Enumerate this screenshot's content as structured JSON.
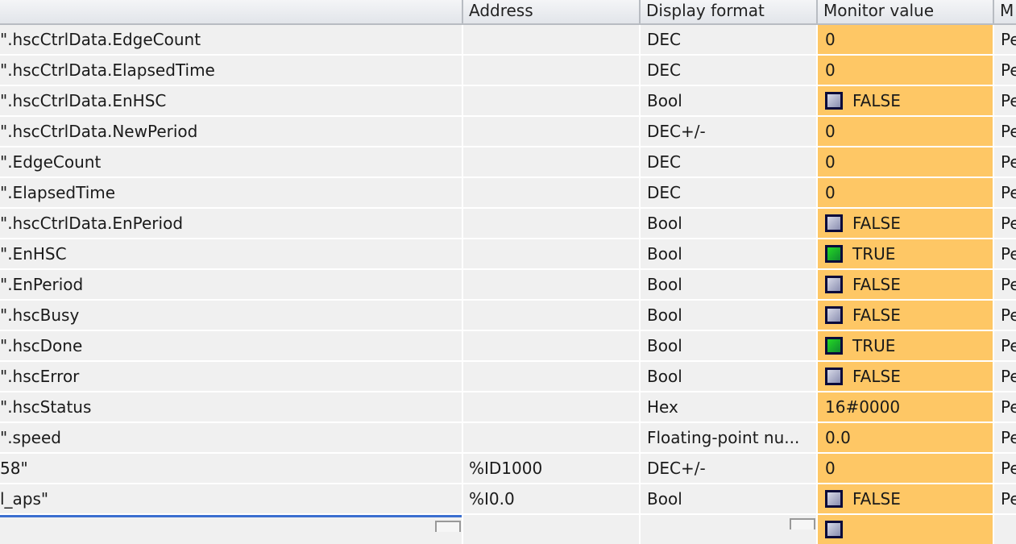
{
  "columns": {
    "name": "",
    "address": "Address",
    "display_format": "Display format",
    "monitor_value": "Monitor value",
    "modify": "M"
  },
  "rows": [
    {
      "name": "\".hscCtrlData.EdgeCount",
      "address": "",
      "format": "DEC",
      "value": "0",
      "bool": null,
      "modify": "Pe"
    },
    {
      "name": "\".hscCtrlData.ElapsedTime",
      "address": "",
      "format": "DEC",
      "value": "0",
      "bool": null,
      "modify": "Pe"
    },
    {
      "name": "\".hscCtrlData.EnHSC",
      "address": "",
      "format": "Bool",
      "value": "FALSE",
      "bool": false,
      "modify": "Pe"
    },
    {
      "name": "\".hscCtrlData.NewPeriod",
      "address": "",
      "format": "DEC+/-",
      "value": "0",
      "bool": null,
      "modify": "Pe"
    },
    {
      "name": "\".EdgeCount",
      "address": "",
      "format": "DEC",
      "value": "0",
      "bool": null,
      "modify": "Pe"
    },
    {
      "name": "\".ElapsedTime",
      "address": "",
      "format": "DEC",
      "value": "0",
      "bool": null,
      "modify": "Pe"
    },
    {
      "name": "\".hscCtrlData.EnPeriod",
      "address": "",
      "format": "Bool",
      "value": "FALSE",
      "bool": false,
      "modify": "Pe"
    },
    {
      "name": "\".EnHSC",
      "address": "",
      "format": "Bool",
      "value": "TRUE",
      "bool": true,
      "modify": "Pe"
    },
    {
      "name": "\".EnPeriod",
      "address": "",
      "format": "Bool",
      "value": "FALSE",
      "bool": false,
      "modify": "Pe"
    },
    {
      "name": "\".hscBusy",
      "address": "",
      "format": "Bool",
      "value": "FALSE",
      "bool": false,
      "modify": "Pe"
    },
    {
      "name": "\".hscDone",
      "address": "",
      "format": "Bool",
      "value": "TRUE",
      "bool": true,
      "modify": "Pe"
    },
    {
      "name": "\".hscError",
      "address": "",
      "format": "Bool",
      "value": "FALSE",
      "bool": false,
      "modify": "Pe"
    },
    {
      "name": "\".hscStatus",
      "address": "",
      "format": "Hex",
      "value": "16#0000",
      "bool": null,
      "modify": "Pe"
    },
    {
      "name": "\".speed",
      "address": "",
      "format": "Floating-point nu...",
      "value": "0.0",
      "bool": null,
      "modify": "Pe"
    },
    {
      "name": "58\"",
      "address": "%ID1000",
      "format": "DEC+/-",
      "value": "0",
      "bool": null,
      "modify": "Pe"
    },
    {
      "name": "l_aps\"",
      "address": "%I0.0",
      "format": "Bool",
      "value": "FALSE",
      "bool": false,
      "modify": "Pe"
    }
  ],
  "colors": {
    "monitor_bg": "#fec765",
    "cell_bg": "#f0f0f0",
    "true_green": "#1fbf2a",
    "edit_border": "#3b6fd0"
  }
}
